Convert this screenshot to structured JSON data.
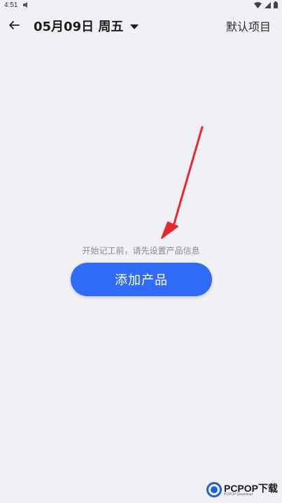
{
  "status_bar": {
    "time": "4:51"
  },
  "toolbar": {
    "date_label": "05月09日 周五",
    "project_label": "默认项目"
  },
  "empty_state": {
    "hint": "开始记工前，请先设置产品信息",
    "add_button_label": "添加产品"
  },
  "watermark": {
    "text": "PCPOP下载",
    "subtext": "PCPOP Download"
  },
  "colors": {
    "background": "#f1f0f5",
    "button": "#2f6bf5",
    "arrow": "#e8282b"
  }
}
